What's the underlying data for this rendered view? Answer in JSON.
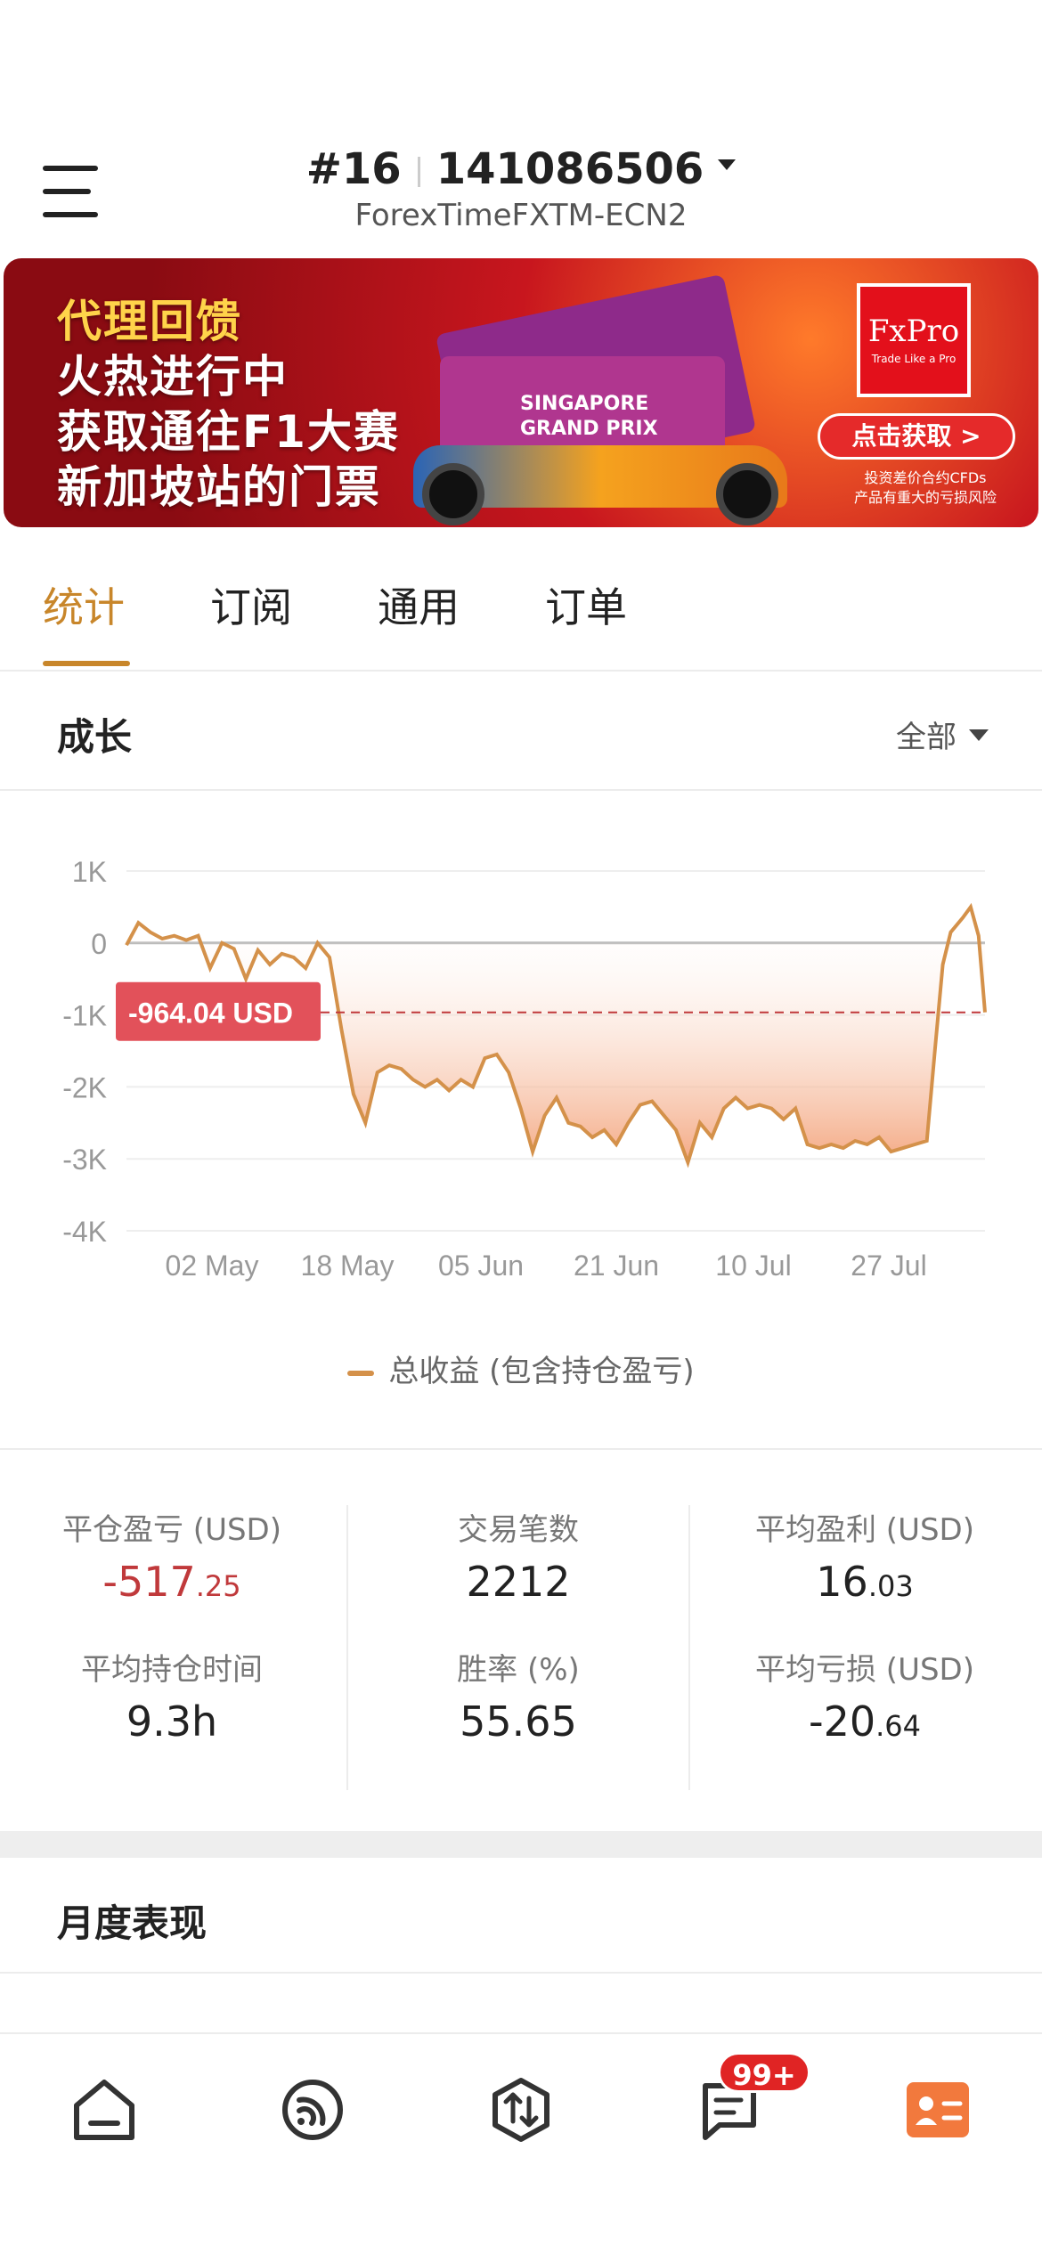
{
  "header": {
    "account_number": "#16",
    "account_id": "141086506",
    "server": "ForexTimeFXTM-ECN2"
  },
  "banner": {
    "line1": "代理回馈",
    "line2": "火热进行中",
    "line3": "获取通往F1大赛",
    "line4": "新加坡站的门票",
    "ticket_text_1": "SINGAPORE",
    "ticket_text_2": "GRAND PRIX",
    "brand": "FxPro",
    "brand_tagline": "Trade Like a Pro",
    "cta": "点击获取 >",
    "disclaimer_1": "投资差价合约CFDs",
    "disclaimer_2": "产品有重大的亏损风险"
  },
  "tabs": [
    {
      "label": "统计",
      "active": true
    },
    {
      "label": "订阅",
      "active": false
    },
    {
      "label": "通用",
      "active": false
    },
    {
      "label": "订单",
      "active": false
    }
  ],
  "growth": {
    "title": "成长",
    "filter": "全部"
  },
  "colors": {
    "accent": "#c8862a",
    "line": "#d4914a",
    "negative": "#c0393b",
    "marker_bg": "#e2515a"
  },
  "chart_data": {
    "type": "area",
    "ylabel": "",
    "xlabel": "",
    "yticks": [
      "1K",
      "0",
      "-1K",
      "-2K",
      "-3K",
      "-4K"
    ],
    "ylim": [
      -4000,
      1000
    ],
    "xticks": [
      "02 May",
      "18 May",
      "05 Jun",
      "21 Jun",
      "10 Jul",
      "27 Jul"
    ],
    "current_value_label": "-964.04 USD",
    "current_value": -964.04,
    "legend": "总收益 (包含持仓盈亏)",
    "series": [
      {
        "name": "总收益 (包含持仓盈亏)",
        "points": [
          [
            0,
            -30
          ],
          [
            1.5,
            280
          ],
          [
            3,
            150
          ],
          [
            4.5,
            60
          ],
          [
            6,
            100
          ],
          [
            7.5,
            40
          ],
          [
            9,
            100
          ],
          [
            10.5,
            -350
          ],
          [
            12,
            0
          ],
          [
            13.5,
            -80
          ],
          [
            15,
            -500
          ],
          [
            16.5,
            -100
          ],
          [
            18,
            -300
          ],
          [
            19.5,
            -150
          ],
          [
            21,
            -200
          ],
          [
            22.5,
            -350
          ],
          [
            24,
            0
          ],
          [
            25.5,
            -200
          ],
          [
            27,
            -1200
          ],
          [
            28.5,
            -2100
          ],
          [
            30,
            -2500
          ],
          [
            31.5,
            -1800
          ],
          [
            33,
            -1700
          ],
          [
            34.5,
            -1750
          ],
          [
            36,
            -1900
          ],
          [
            37.5,
            -2000
          ],
          [
            39,
            -1900
          ],
          [
            40.5,
            -2050
          ],
          [
            42,
            -1900
          ],
          [
            43.5,
            -2000
          ],
          [
            45,
            -1600
          ],
          [
            46.5,
            -1550
          ],
          [
            48,
            -1800
          ],
          [
            49.5,
            -2300
          ],
          [
            51,
            -2900
          ],
          [
            52.5,
            -2400
          ],
          [
            54,
            -2150
          ],
          [
            55.5,
            -2500
          ],
          [
            57,
            -2550
          ],
          [
            58.5,
            -2700
          ],
          [
            60,
            -2600
          ],
          [
            61.5,
            -2800
          ],
          [
            63,
            -2500
          ],
          [
            64.5,
            -2250
          ],
          [
            66,
            -2200
          ],
          [
            67.5,
            -2400
          ],
          [
            69,
            -2600
          ],
          [
            70.5,
            -3050
          ],
          [
            72,
            -2500
          ],
          [
            73.5,
            -2700
          ],
          [
            75,
            -2300
          ],
          [
            76.5,
            -2150
          ],
          [
            78,
            -2300
          ],
          [
            79.5,
            -2250
          ],
          [
            81,
            -2300
          ],
          [
            82.5,
            -2450
          ],
          [
            84,
            -2300
          ],
          [
            85.5,
            -2800
          ],
          [
            87,
            -2850
          ],
          [
            88.5,
            -2800
          ],
          [
            90,
            -2850
          ],
          [
            91.5,
            -2750
          ],
          [
            93,
            -2800
          ],
          [
            94.5,
            -2700
          ],
          [
            96,
            -2900
          ],
          [
            97.5,
            -2850
          ],
          [
            99,
            -2800
          ],
          [
            100.5,
            -2750
          ],
          [
            101.5,
            -1500
          ],
          [
            102.5,
            -300
          ],
          [
            103.5,
            150
          ],
          [
            105,
            350
          ],
          [
            106,
            500
          ],
          [
            107,
            100
          ],
          [
            107.8,
            -964.04
          ]
        ]
      }
    ]
  },
  "stats": [
    {
      "label": "平仓盈亏 (USD)",
      "int": "-517",
      "frac": ".25",
      "negative": true
    },
    {
      "label": "交易笔数",
      "int": "2212",
      "frac": "",
      "negative": false
    },
    {
      "label": "平均盈利 (USD)",
      "int": "16",
      "frac": ".03",
      "negative": false
    },
    {
      "label": "平均持仓时间",
      "int": "9.3h",
      "frac": "",
      "negative": false
    },
    {
      "label": "胜率 (%)",
      "int": "55.65",
      "frac": "",
      "negative": false
    },
    {
      "label": "平均亏损 (USD)",
      "int": "-20",
      "frac": ".64",
      "negative": false
    }
  ],
  "monthly": {
    "title": "月度表现"
  },
  "bottom_nav": {
    "items": [
      {
        "icon": "home-icon"
      },
      {
        "icon": "signal-feed-icon"
      },
      {
        "icon": "trade-icon"
      },
      {
        "icon": "messages-icon"
      },
      {
        "icon": "profile-card-icon"
      }
    ],
    "badge": "99+"
  }
}
